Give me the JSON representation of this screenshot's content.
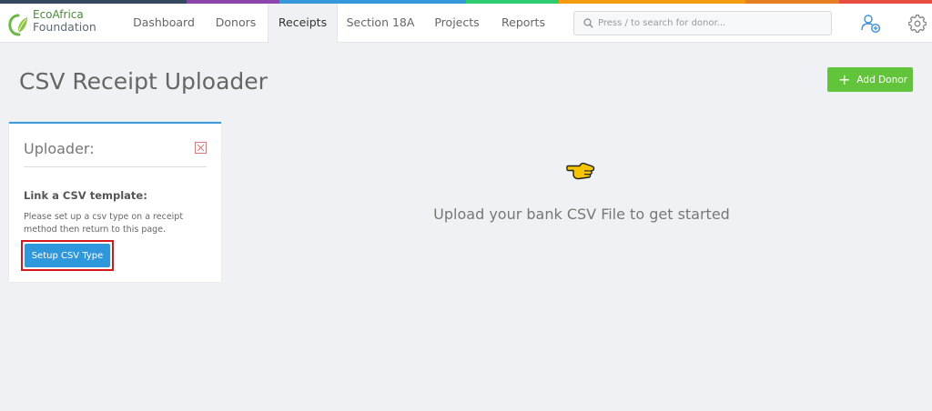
{
  "colors": {
    "rainbow": [
      "#34495e",
      "#34495e",
      "#8e44ad",
      "#3498db",
      "#3498db",
      "#2ecc71",
      "#f39c12",
      "#f39c12",
      "#e67e22",
      "#e74c3c"
    ],
    "accent": "#2f97dc",
    "success": "#62c43b",
    "highlight": "#d3191d"
  },
  "brand": {
    "line1": "EcoAfrica",
    "line2": "Foundation",
    "icon": "leaf-logo-icon"
  },
  "nav": {
    "tabs": [
      {
        "label": "Dashboard",
        "active": false
      },
      {
        "label": "Donors",
        "active": false
      },
      {
        "label": "Receipts",
        "active": true
      },
      {
        "label": "Section 18A",
        "active": false
      },
      {
        "label": "Projects",
        "active": false
      },
      {
        "label": "Reports",
        "active": false
      }
    ]
  },
  "search": {
    "placeholder": "Press / to search for donor...",
    "value": "",
    "icon": "search-icon"
  },
  "header_icons": {
    "add_user": "add-user-icon",
    "settings": "gear-icon"
  },
  "page": {
    "title": "CSV Receipt Uploader",
    "add_donor_label": "Add Donor"
  },
  "uploader": {
    "title": "Uploader:",
    "subtitle": "Link a CSV template:",
    "text": "Please set up a csv type on a receipt method then return to this page.",
    "button_label": "Setup CSV Type"
  },
  "empty_state": {
    "icon": "pointing-hand-icon",
    "message": "Upload your bank CSV File to get started"
  }
}
